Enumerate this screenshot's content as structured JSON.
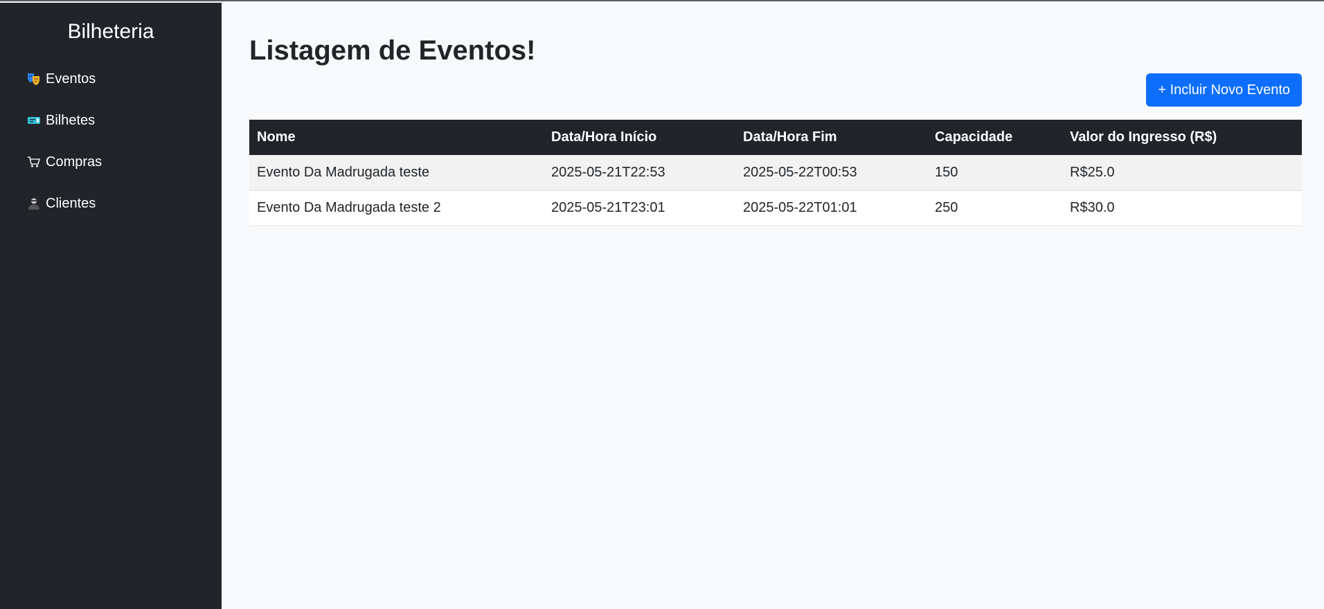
{
  "sidebar": {
    "brand": "Bilheteria",
    "items": [
      {
        "icon": "theater-masks-icon",
        "label": "Eventos"
      },
      {
        "icon": "ticket-icon",
        "label": "Bilhetes"
      },
      {
        "icon": "shopping-cart-icon",
        "label": "Compras"
      },
      {
        "icon": "user-icon",
        "label": "Clientes"
      }
    ]
  },
  "main": {
    "title": "Listagem de Eventos!",
    "add_button_label": "+ Incluir Novo Evento",
    "table": {
      "columns": [
        "Nome",
        "Data/Hora Início",
        "Data/Hora Fim",
        "Capacidade",
        "Valor do Ingresso (R$)"
      ],
      "rows": [
        [
          "Evento Da Madrugada teste",
          "2025-05-21T22:53",
          "2025-05-22T00:53",
          "150",
          "R$25.0"
        ],
        [
          "Evento Da Madrugada teste 2",
          "2025-05-21T23:01",
          "2025-05-22T01:01",
          "250",
          "R$30.0"
        ]
      ]
    }
  },
  "colors": {
    "sidebar_bg": "#212529",
    "page_bg": "#f8f9fa",
    "primary": "#0d6efd",
    "table_header_bg": "#212529"
  }
}
